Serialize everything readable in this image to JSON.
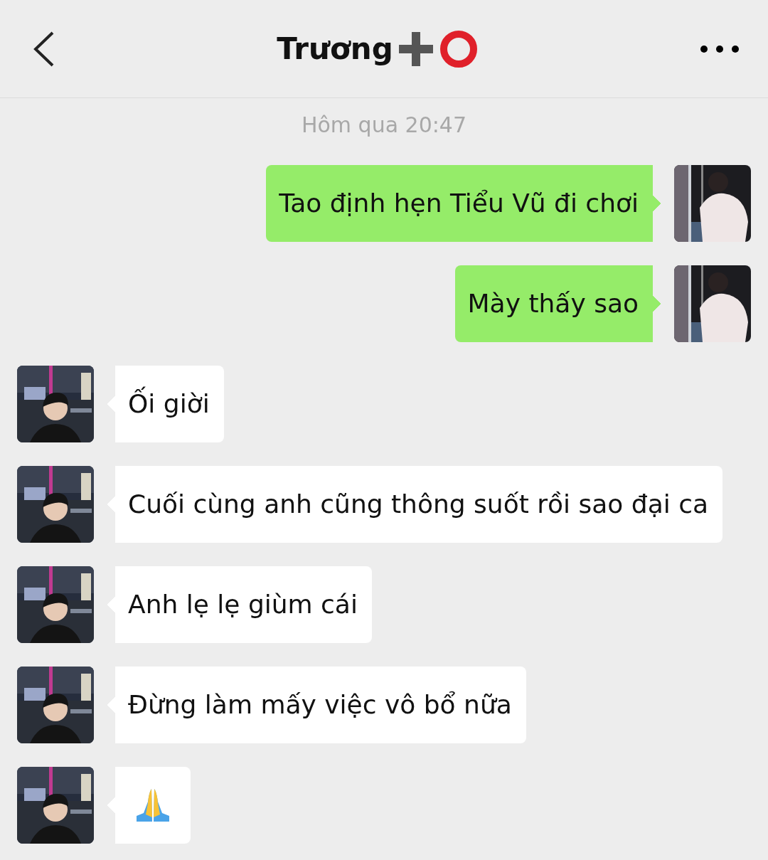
{
  "header": {
    "title": "Trương"
  },
  "timestamp": "Hôm qua 20:47",
  "messages": [
    {
      "outgoing": true,
      "kind": "text",
      "text": "Tao định hẹn Tiểu Vũ đi chơi"
    },
    {
      "outgoing": true,
      "kind": "text",
      "text": "Mày thấy sao"
    },
    {
      "outgoing": false,
      "kind": "text",
      "text": "Ối giời"
    },
    {
      "outgoing": false,
      "kind": "text",
      "text": "Cuối cùng anh cũng thông suốt rồi sao đại ca"
    },
    {
      "outgoing": false,
      "kind": "text",
      "text": "Anh lẹ lẹ giùm cái"
    },
    {
      "outgoing": false,
      "kind": "text",
      "text": "Đừng làm mấy việc vô bổ nữa"
    },
    {
      "outgoing": false,
      "kind": "icon"
    }
  ]
}
